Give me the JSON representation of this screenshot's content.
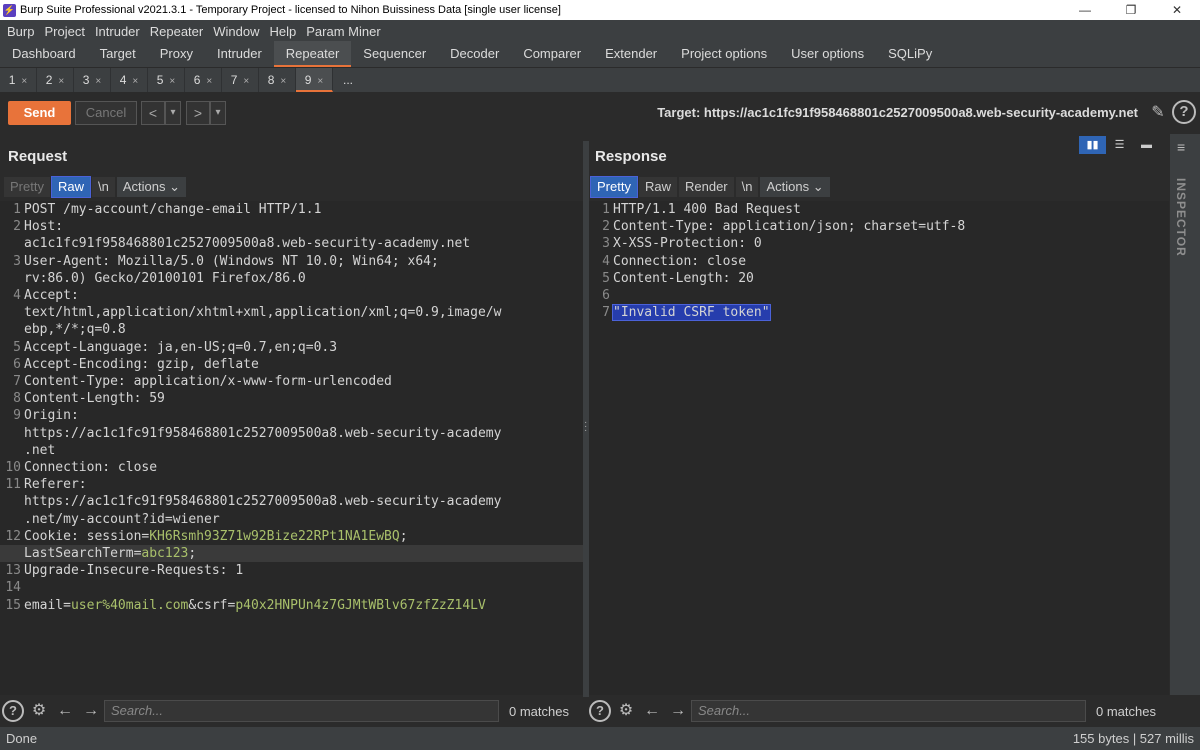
{
  "window": {
    "title": "Burp Suite Professional v2021.3.1 - Temporary Project - licensed to Nihon Buissiness Data [single user license]",
    "controls": [
      "—",
      "❐",
      "✕"
    ]
  },
  "menu": [
    "Burp",
    "Project",
    "Intruder",
    "Repeater",
    "Window",
    "Help",
    "Param Miner"
  ],
  "tabs": [
    "Dashboard",
    "Target",
    "Proxy",
    "Intruder",
    "Repeater",
    "Sequencer",
    "Decoder",
    "Comparer",
    "Extender",
    "Project options",
    "User options",
    "SQLiPy"
  ],
  "active_tab": "Repeater",
  "repeater_tabs": [
    "1",
    "2",
    "3",
    "4",
    "5",
    "6",
    "7",
    "8",
    "9"
  ],
  "repeater_tab_close": "×",
  "repeater_more": "...",
  "active_repeater_tab": "9",
  "toolbar": {
    "send": "Send",
    "cancel": "Cancel",
    "back": "<",
    "back_menu": "▾",
    "forward": ">",
    "forward_menu": "▾",
    "target": "Target: https://ac1c1fc91f958468801c2527009500a8.web-security-academy.net",
    "help": "?"
  },
  "request": {
    "title": "Request",
    "tabs": [
      "Pretty",
      "Raw",
      "\\n",
      "Actions"
    ],
    "actions_arrow": "⌄",
    "lines": [
      {
        "n": "1",
        "rows": [
          [
            [
              "k",
              "POST /my-account/change-email HTTP/1.1"
            ]
          ]
        ]
      },
      {
        "n": "2",
        "rows": [
          [
            [
              "k",
              "Host:"
            ]
          ],
          [
            [
              "k",
              "ac1c1fc91f958468801c2527009500a8.web-security-academy.net"
            ]
          ]
        ]
      },
      {
        "n": "3",
        "rows": [
          [
            [
              "k",
              "User-Agent: Mozilla/5.0 (Windows NT 10.0; Win64; x64;"
            ]
          ],
          [
            [
              "k",
              "rv:86.0) Gecko/20100101 Firefox/86.0"
            ]
          ]
        ]
      },
      {
        "n": "4",
        "rows": [
          [
            [
              "k",
              "Accept:"
            ]
          ],
          [
            [
              "k",
              "text/html,application/xhtml+xml,application/xml;q=0.9,image/w"
            ]
          ],
          [
            [
              "k",
              "ebp,*/*;q=0.8"
            ]
          ]
        ]
      },
      {
        "n": "5",
        "rows": [
          [
            [
              "k",
              "Accept-Language: ja,en-US;q=0.7,en;q=0.3"
            ]
          ]
        ]
      },
      {
        "n": "6",
        "rows": [
          [
            [
              "k",
              "Accept-Encoding: gzip, deflate"
            ]
          ]
        ]
      },
      {
        "n": "7",
        "rows": [
          [
            [
              "k",
              "Content-Type: application/x-www-form-urlencoded"
            ]
          ]
        ]
      },
      {
        "n": "8",
        "rows": [
          [
            [
              "k",
              "Content-Length: 59"
            ]
          ]
        ]
      },
      {
        "n": "9",
        "rows": [
          [
            [
              "k",
              "Origin:"
            ]
          ],
          [
            [
              "k",
              "https://ac1c1fc91f958468801c2527009500a8.web-security-academy"
            ]
          ],
          [
            [
              "k",
              ".net"
            ]
          ]
        ]
      },
      {
        "n": "10",
        "rows": [
          [
            [
              "k",
              "Connection: close"
            ]
          ]
        ]
      },
      {
        "n": "11",
        "rows": [
          [
            [
              "k",
              "Referer:"
            ]
          ],
          [
            [
              "k",
              "https://ac1c1fc91f958468801c2527009500a8.web-security-academy"
            ]
          ],
          [
            [
              "k",
              ".net/my-account?id=wiener"
            ]
          ]
        ]
      },
      {
        "n": "12",
        "rows": [
          [
            [
              "k",
              "Cookie: session="
            ],
            [
              "v",
              "KH6Rsmh93Z71w92Bize22RPt1NA1EwBQ"
            ],
            [
              "k",
              ";"
            ]
          ],
          [
            [
              "k",
              "LastSearchTerm="
            ],
            [
              "v",
              "abc123"
            ],
            [
              "k",
              ";"
            ]
          ]
        ],
        "hl_last": true
      },
      {
        "n": "13",
        "rows": [
          [
            [
              "k",
              "Upgrade-Insecure-Requests: 1"
            ]
          ]
        ]
      },
      {
        "n": "14",
        "rows": [
          [
            [
              "k",
              ""
            ]
          ]
        ]
      },
      {
        "n": "15",
        "rows": [
          [
            [
              "k",
              "email="
            ],
            [
              "v",
              "user%40mail.com"
            ],
            [
              "k",
              "&csrf="
            ],
            [
              "v",
              "p40x2HNPUn4z7GJMtWBlv67zfZzZ14LV"
            ]
          ]
        ]
      }
    ]
  },
  "response": {
    "title": "Response",
    "tabs": [
      "Pretty",
      "Raw",
      "Render",
      "\\n",
      "Actions"
    ],
    "actions_arrow": "⌄",
    "lines": [
      {
        "n": "1",
        "rows": [
          [
            [
              "k",
              "HTTP/1.1 400 Bad Request"
            ]
          ]
        ]
      },
      {
        "n": "2",
        "rows": [
          [
            [
              "k",
              "Content-Type: application/json; charset=utf-8"
            ]
          ]
        ]
      },
      {
        "n": "3",
        "rows": [
          [
            [
              "k",
              "X-XSS-Protection: 0"
            ]
          ]
        ]
      },
      {
        "n": "4",
        "rows": [
          [
            [
              "k",
              "Connection: close"
            ]
          ]
        ]
      },
      {
        "n": "5",
        "rows": [
          [
            [
              "k",
              "Content-Length: 20"
            ]
          ]
        ]
      },
      {
        "n": "6",
        "rows": [
          [
            [
              "k",
              ""
            ]
          ]
        ]
      },
      {
        "n": "7",
        "rows": [
          [
            [
              "sel",
              "\"Invalid CSRF token\""
            ]
          ]
        ]
      }
    ]
  },
  "search": {
    "placeholder": "Search...",
    "matches": "0 matches",
    "help": "?"
  },
  "inspector": {
    "label": "INSPECTOR"
  },
  "status": {
    "left": "Done",
    "right": "155 bytes | 527 millis"
  },
  "colors": {
    "accent": "#e8733a",
    "selected_tab": "#2f65b5",
    "value_green": "#a9c06b",
    "selection": "#263dad"
  }
}
